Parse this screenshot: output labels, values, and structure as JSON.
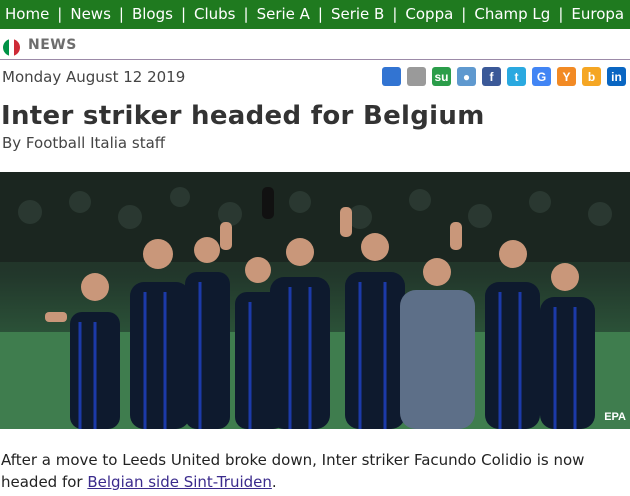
{
  "nav": {
    "items": [
      "Home",
      "News",
      "Blogs",
      "Clubs",
      "Serie A",
      "Serie B",
      "Coppa",
      "Champ Lg",
      "Europa"
    ],
    "separator": "|"
  },
  "section": {
    "label": "NEWS",
    "flag_colors": [
      "#009246",
      "#ffffff",
      "#ce2b37"
    ]
  },
  "article": {
    "date": "Monday August 12 2019",
    "headline": "Inter striker headed for Belgium",
    "byline": "By Football Italia staff",
    "photo_credit": "EPA",
    "body_before": "After a move to Leeds United broke down, Inter striker Facundo Colidio is now headed for ",
    "body_link": "Belgian side Sint-Truiden",
    "body_after": "."
  },
  "share_icons": [
    {
      "name": "delicious-icon",
      "glyph": "",
      "color": "#3274d2"
    },
    {
      "name": "myspace-icon",
      "glyph": "",
      "color": "#9a9a9a"
    },
    {
      "name": "stumbleupon-icon",
      "glyph": "su",
      "color": "#2b9d4a"
    },
    {
      "name": "reddit-icon",
      "glyph": "●",
      "color": "#5f99cf"
    },
    {
      "name": "facebook-icon",
      "glyph": "f",
      "color": "#3b5998"
    },
    {
      "name": "twitter-icon",
      "glyph": "t",
      "color": "#2aa9e0"
    },
    {
      "name": "google-icon",
      "glyph": "G",
      "color": "#4285f4"
    },
    {
      "name": "yahoo-icon",
      "glyph": "Y",
      "color": "#f28a24"
    },
    {
      "name": "blogger-icon",
      "glyph": "b",
      "color": "#f5a623"
    },
    {
      "name": "linkedin-icon",
      "glyph": "in",
      "color": "#0a66c2"
    }
  ]
}
